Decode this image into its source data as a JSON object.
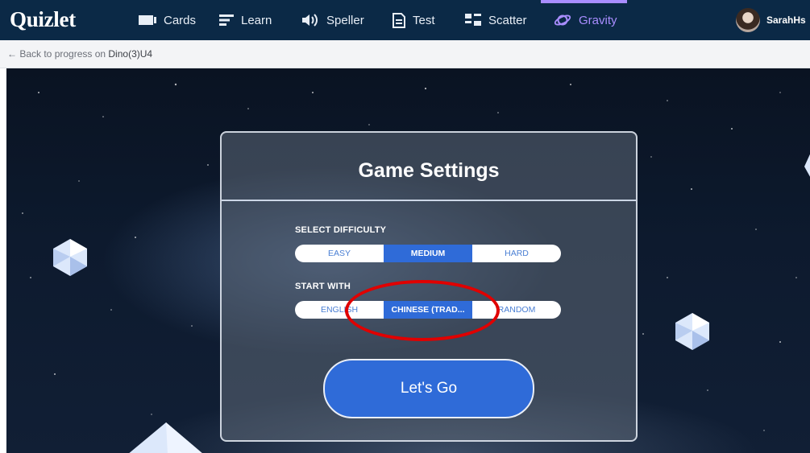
{
  "app": {
    "logo": "Quizlet"
  },
  "nav": {
    "items": [
      {
        "label": "Cards",
        "icon": "cards-icon"
      },
      {
        "label": "Learn",
        "icon": "learn-icon"
      },
      {
        "label": "Speller",
        "icon": "speaker-icon"
      },
      {
        "label": "Test",
        "icon": "test-icon"
      },
      {
        "label": "Scatter",
        "icon": "scatter-icon"
      },
      {
        "label": "Gravity",
        "icon": "planet-icon",
        "active": true
      }
    ]
  },
  "user": {
    "name": "SarahHs"
  },
  "breadcrumb": {
    "prefix": "← Back to progress on ",
    "set_name": "Dino(3)U4"
  },
  "settings": {
    "title": "Game Settings",
    "difficulty_label": "SELECT DIFFICULTY",
    "difficulty_options": [
      "EASY",
      "MEDIUM",
      "HARD"
    ],
    "difficulty_selected": "MEDIUM",
    "start_label": "START WITH",
    "start_options": [
      "ENGLISH",
      "CHINESE (TRAD...",
      "RANDOM"
    ],
    "start_selected": "CHINESE (TRAD...",
    "go_label": "Let's Go"
  },
  "colors": {
    "nav_bg": "#0b2946",
    "accent": "#2f6bd8",
    "active_nav": "#a98dff",
    "annotation": "#e00000"
  }
}
